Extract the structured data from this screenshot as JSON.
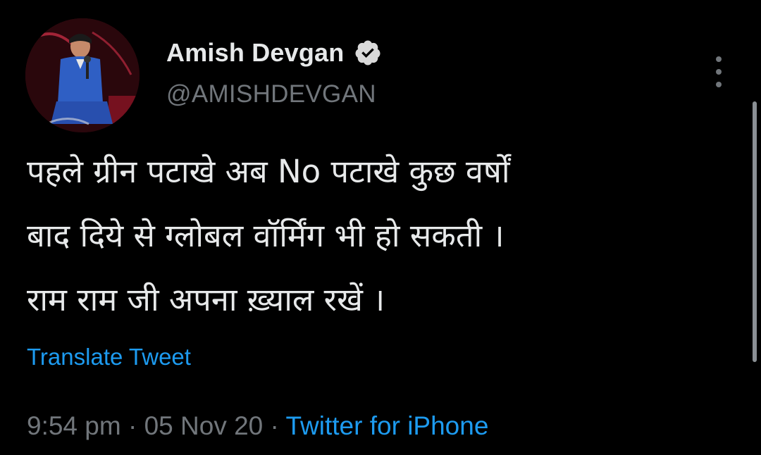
{
  "author": {
    "display_name": "Amish Devgan",
    "handle": "@AMISHDEVGAN",
    "verified": true
  },
  "tweet": {
    "lines": [
      "पहले ग्रीन पटाखे अब No पटाखे कुछ वर्षों",
      "बाद दिये से ग्लोबल वॉर्मिंग भी हो सकती ।",
      "राम राम जी अपना ख़्याल रखें ।"
    ],
    "translate_label": "Translate Tweet",
    "time": "9:54 pm",
    "separator": "·",
    "date": "05 Nov 20",
    "source": "Twitter for iPhone"
  },
  "icons": {
    "verified": "verified-badge-icon",
    "more": "more-options-icon"
  },
  "colors": {
    "background": "#000000",
    "text_primary": "#e7e9ea",
    "text_secondary": "#71767b",
    "accent": "#1d9bf0"
  }
}
